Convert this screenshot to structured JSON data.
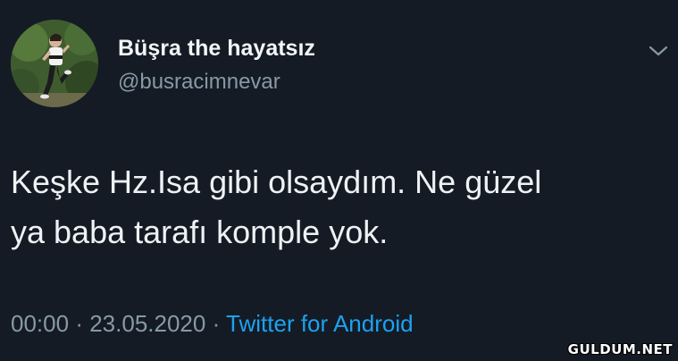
{
  "author": {
    "display_name": "Büşra the hayatsız",
    "handle": "@busracimnevar"
  },
  "tweet": {
    "lines": [
      "Keşke Hz.Isa gibi olsaydım. Ne güzel",
      "ya baba tarafı komple yok."
    ]
  },
  "meta": {
    "time": "00:00",
    "separator": "·",
    "date": "23.05.2020",
    "source": "Twitter for Android"
  },
  "watermark": "GULDUM.NET",
  "icons": {
    "menu": "chevron-down-icon"
  },
  "colors": {
    "background": "#141b24",
    "text": "#eef2f5",
    "secondary": "#8899a6",
    "link": "#1da1f2"
  }
}
